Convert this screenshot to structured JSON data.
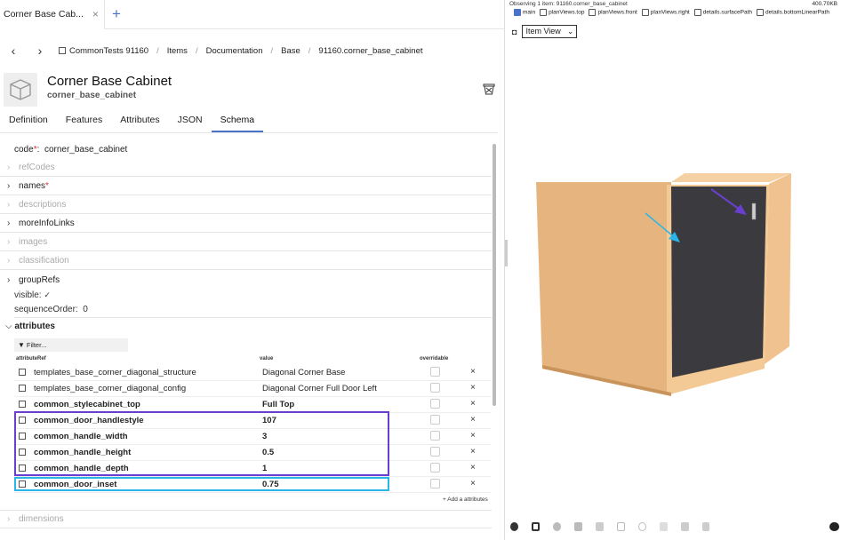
{
  "tab": {
    "title": "Corner Base Cab...",
    "close": "×",
    "add": "+"
  },
  "breadcrumb": [
    "CommonTests 91160",
    "Items",
    "Documentation",
    "Base",
    "91160.corner_base_cabinet"
  ],
  "nav": {
    "back": "‹",
    "forward": "›"
  },
  "item": {
    "title": "Corner Base Cabinet",
    "code": "corner_base_cabinet"
  },
  "tabs": [
    "Definition",
    "Features",
    "Attributes",
    "JSON",
    "Schema"
  ],
  "active_tab": "Schema",
  "schema": {
    "code_label": "code",
    "code_value": "corner_base_cabinet",
    "sections": [
      {
        "label": "refCodes",
        "dim": true
      },
      {
        "label": "names",
        "dim": false,
        "required": true
      },
      {
        "label": "descriptions",
        "dim": true
      },
      {
        "label": "moreInfoLinks",
        "dim": false
      },
      {
        "label": "images",
        "dim": true
      },
      {
        "label": "classification",
        "dim": true
      },
      {
        "label": "groupRefs",
        "dim": false
      }
    ],
    "visible_label": "visible:",
    "visible_value": "✓",
    "sequence_label": "sequenceOrder:",
    "sequence_value": "0",
    "attributes_label": "attributes",
    "filter_placeholder": "Filter...",
    "columns": {
      "ref": "attributeRef",
      "value": "value",
      "override": "overridable"
    },
    "attributes": [
      {
        "ref": "templates_base_corner_diagonal_structure",
        "value": "Diagonal Corner Base",
        "bold": false
      },
      {
        "ref": "templates_base_corner_diagonal_config",
        "value": "Diagonal Corner Full Door Left",
        "bold": false
      },
      {
        "ref": "common_stylecabinet_top",
        "value": "Full Top",
        "bold": true
      },
      {
        "ref": "common_door_handlestyle",
        "value": "107",
        "bold": true
      },
      {
        "ref": "common_handle_width",
        "value": "3",
        "bold": true
      },
      {
        "ref": "common_handle_height",
        "value": "0.5",
        "bold": true
      },
      {
        "ref": "common_handle_depth",
        "value": "1",
        "bold": true
      },
      {
        "ref": "common_door_inset",
        "value": "0.75",
        "bold": true
      }
    ],
    "remove": "×",
    "add_attribute": "+ Add a attributes",
    "dimensions_label": "dimensions"
  },
  "viewer": {
    "observing": "Observing 1 item: 91160.corner_base_cabinet",
    "size": "400.70KB",
    "layers": [
      {
        "label": "main",
        "checked": true
      },
      {
        "label": "planViews.top",
        "checked": false
      },
      {
        "label": "planViews.front",
        "checked": false
      },
      {
        "label": "planViews.right",
        "checked": false
      },
      {
        "label": "details.surfacePath",
        "checked": false
      },
      {
        "label": "details.bottomLinearPath",
        "checked": false
      }
    ],
    "view_select": "Item View"
  },
  "colors": {
    "accent": "#4a72c8",
    "highlight_purple": "#6a3fcf",
    "highlight_cyan": "#29b6e8",
    "cabinet_body": "#f0c290",
    "door": "#3b3b3f"
  }
}
